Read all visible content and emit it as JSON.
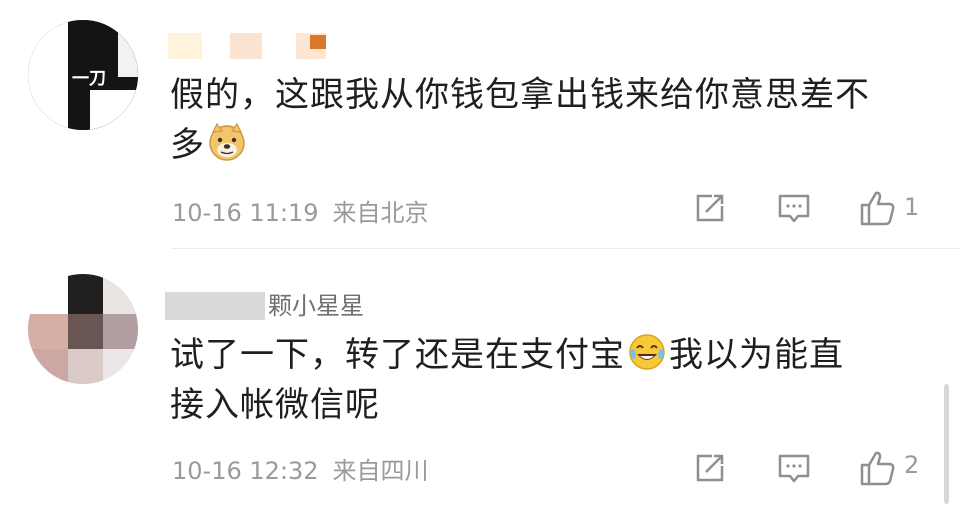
{
  "comments": [
    {
      "avatar_text": "一刀",
      "name": "",
      "text_line1": "假的，这跟我从你钱包拿出钱来给你意思差不",
      "text_line2": "多",
      "emoji": "doge-emoji",
      "date": "10-16 11:19",
      "location": "来自北京",
      "likes": "1"
    },
    {
      "name": "颗小星星",
      "text_line1a": "试了一下，转了还是在支付宝",
      "emoji": "laugh-cry-emoji",
      "text_line1b": "我以为能直",
      "text_line2": "接入帐微信呢",
      "date": "10-16 12:32",
      "location": "来自四川",
      "likes": "2"
    }
  ],
  "icons": {
    "share": "share-icon",
    "reply": "comment-icon",
    "like": "thumbs-up-icon"
  },
  "colors": {
    "text": "#1f1f1f",
    "meta": "#9a9a9a",
    "icon": "#9a9a9a"
  }
}
